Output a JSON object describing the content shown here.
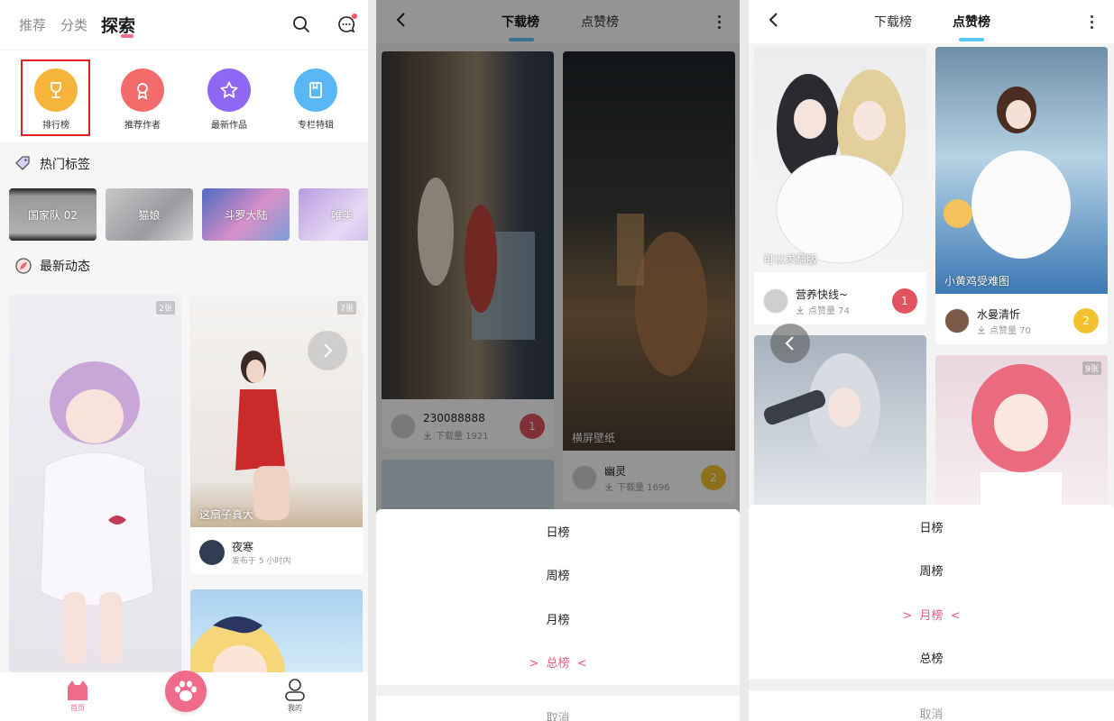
{
  "panel1": {
    "tabs": [
      "推荐",
      "分类",
      "探索"
    ],
    "categories": [
      {
        "label": "排行榜",
        "icon": "trophy-icon",
        "color": "#f7b43a"
      },
      {
        "label": "推荐作者",
        "icon": "award-icon",
        "color": "#f26c6c"
      },
      {
        "label": "最新作品",
        "icon": "star-icon",
        "color": "#8f67f3"
      },
      {
        "label": "专栏特辑",
        "icon": "book-icon",
        "color": "#5ab7f5"
      }
    ],
    "hot_tags_title": "热门标签",
    "tags": [
      "国家队 02",
      "猫娘",
      "斗罗大陆",
      "唯美"
    ],
    "latest_title": "最新动态",
    "feed": {
      "left_count": "2张",
      "right_count": "7张",
      "right_caption": "这扇子真大",
      "right_user": "夜寒",
      "right_time": "发布于 5 小时内"
    },
    "bottom_nav": {
      "home": "首页",
      "mine": "我的"
    }
  },
  "panel2": {
    "tabs": [
      "下载榜",
      "点赞榜"
    ],
    "cards": [
      {
        "user": "230088888",
        "downloads": "下载量 1921",
        "rank": "1"
      },
      {
        "caption": "横屏壁纸",
        "user": "幽灵",
        "downloads": "下载量 1696",
        "rank": "2"
      }
    ],
    "sheet": {
      "items": [
        "日榜",
        "周榜",
        "月榜",
        "总榜"
      ],
      "selected": "总榜",
      "cancel": "取消"
    }
  },
  "panel3": {
    "tabs": [
      "下载榜",
      "点赞榜"
    ],
    "cards": [
      {
        "caption": "可以求翻版",
        "user": "营养快线~",
        "downloads": "点赞量 74",
        "rank": "1"
      },
      {
        "caption": "小黄鸡受难图",
        "user": "水曼清忻",
        "downloads": "点赞量 70",
        "rank": "2"
      },
      {
        "count": "9张"
      }
    ],
    "sheet": {
      "items": [
        "日榜",
        "周榜",
        "月榜",
        "总榜"
      ],
      "selected": "月榜",
      "cancel": "取消"
    }
  },
  "colors": {
    "accent": "#f06b8a",
    "rank1": "#e0535f",
    "rank2": "#f1c22e",
    "tab_underline": "#5ac8f4"
  }
}
